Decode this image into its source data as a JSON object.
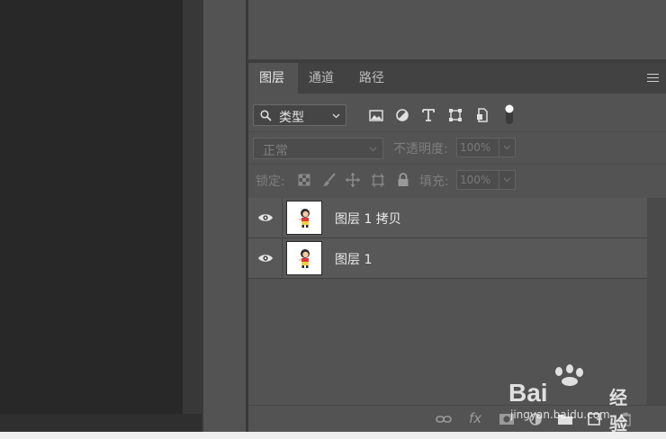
{
  "tabs": [
    {
      "label": "图层",
      "active": true
    },
    {
      "label": "通道",
      "active": false
    },
    {
      "label": "路径",
      "active": false
    }
  ],
  "filter": {
    "label": "类型",
    "icons": [
      "search-icon",
      "image-filter-icon",
      "adjustment-filter-icon",
      "type-filter-icon",
      "shape-filter-icon",
      "smart-object-filter-icon",
      "filter-toggle-icon"
    ]
  },
  "blend": {
    "mode": "正常",
    "opacity_label": "不透明度:",
    "opacity_value": "100%"
  },
  "lock": {
    "label": "锁定:",
    "icons": [
      "lock-transparent-icon",
      "lock-image-icon",
      "lock-position-icon",
      "lock-artboard-icon",
      "lock-all-icon"
    ],
    "fill_label": "填充:",
    "fill_value": "100%"
  },
  "layers": [
    {
      "name": "图层 1 拷贝",
      "visible": true
    },
    {
      "name": "图层 1",
      "visible": true
    }
  ],
  "bottom_toolbar": {
    "icons": [
      "link-icon",
      "fx-icon",
      "mask-icon",
      "adjustment-layer-icon",
      "group-icon",
      "new-layer-icon",
      "trash-icon"
    ],
    "fx_text": "fx"
  },
  "watermark": {
    "brand": "Bai",
    "brand2": "经验",
    "url": "jingyan.baidu.com"
  }
}
